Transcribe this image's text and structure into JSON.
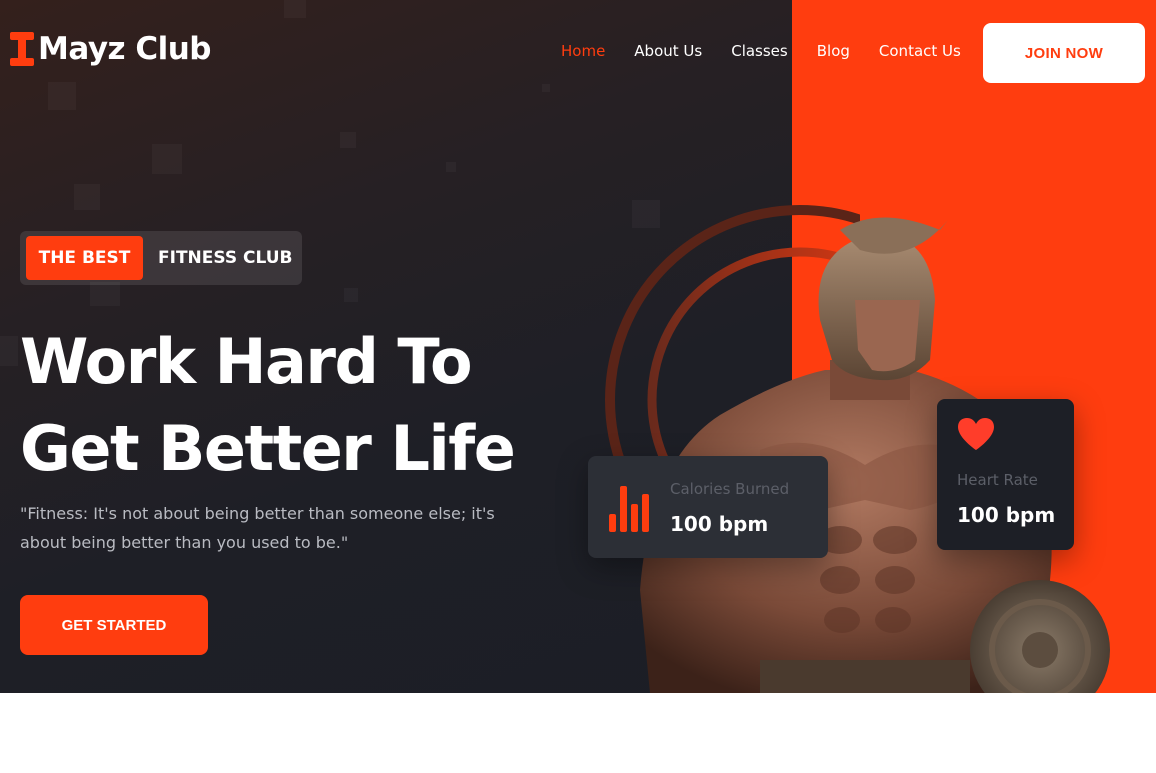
{
  "brand": {
    "name": "Mayz Club",
    "accent": "#ff3d0f"
  },
  "nav": {
    "items": [
      {
        "label": "Home",
        "active": true
      },
      {
        "label": "About Us",
        "active": false
      },
      {
        "label": "Classes",
        "active": false
      },
      {
        "label": "Blog",
        "active": false
      },
      {
        "label": "Contact Us",
        "active": false
      }
    ],
    "join_label": "JOIN NOW"
  },
  "hero": {
    "badge_accent": "THE BEST",
    "badge_text": "FITNESS CLUB",
    "headline_line1": "Work Hard To",
    "headline_line2": "Get Better Life",
    "quote": "\"Fitness: It's not about being better than someone else; it's about being better than you used to be.\"",
    "cta_label": "GET STARTED",
    "image_icon": "warrior-image"
  },
  "stats": {
    "calories": {
      "label": "Calories Burned",
      "value": "100 bpm",
      "icon": "bar-chart-icon"
    },
    "heart": {
      "label": "Heart Rate",
      "value": "100 bpm",
      "icon": "heart-icon"
    }
  }
}
